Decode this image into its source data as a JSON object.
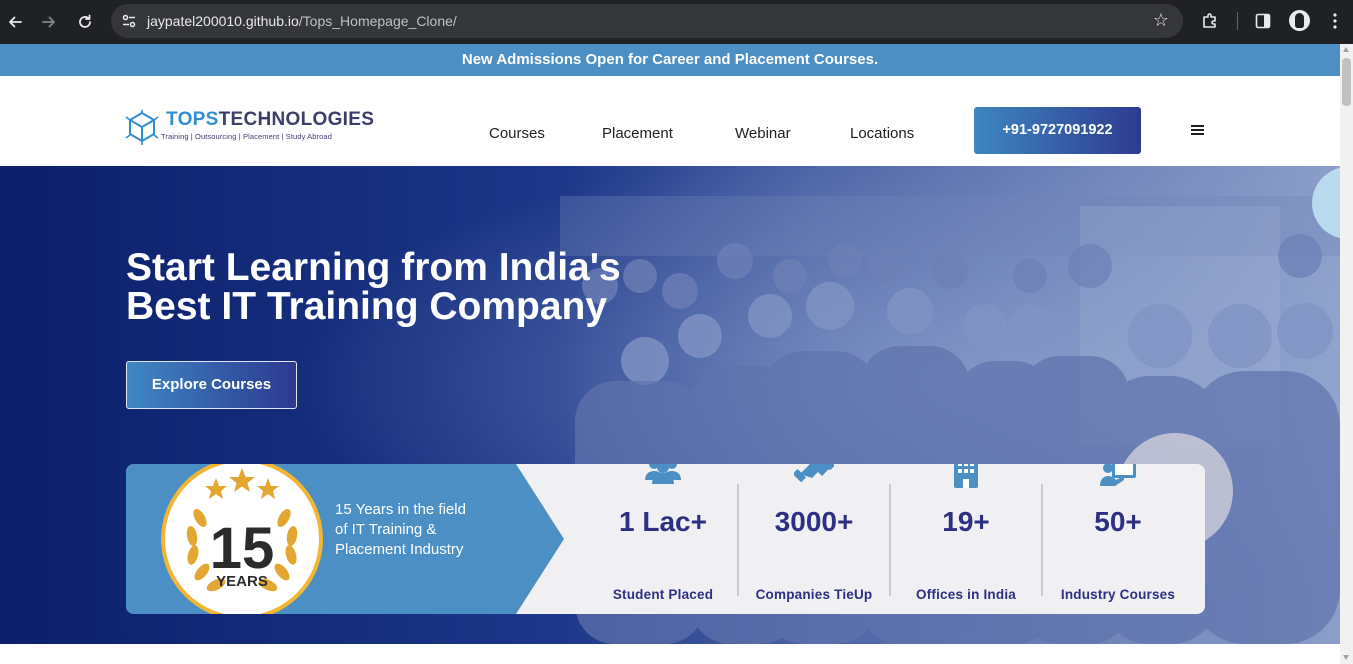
{
  "browser": {
    "url_host": "jaypatel200010.github.io",
    "url_path": "/Tops_Homepage_Clone/",
    "icons": [
      "back-icon",
      "forward-icon",
      "reload-icon",
      "site-settings-icon",
      "bookmark-star-icon",
      "extensions-icon",
      "side-panel-icon",
      "profile-avatar",
      "kebab-menu-icon"
    ]
  },
  "announcement": {
    "text": "New Admissions Open for Career and Placement Courses."
  },
  "header": {
    "logo": {
      "brand_part1": "TOPS",
      "brand_part2": "TECHNOLOGIES",
      "tagline": "Training  |  Outsourcing  |  Placement  |  Study Abroad"
    },
    "nav": [
      {
        "label": "Courses"
      },
      {
        "label": "Placement"
      },
      {
        "label": "Webinar"
      },
      {
        "label": "Locations"
      }
    ],
    "phone_button": "+91-9727091922",
    "menu_icon": "hamburger-icon"
  },
  "hero": {
    "title_line1": "Start Learning from India's",
    "title_line2": "Best IT Training Company",
    "cta": "Explore Courses"
  },
  "stats": {
    "badge_number": "15",
    "badge_caption": "YEARS",
    "years_line1": "15 Years in the field",
    "years_line2": "of IT Training &",
    "years_line3": "Placement Industry",
    "items": [
      {
        "value": "1 Lac+",
        "label": "Student Placed",
        "icon": "students-icon"
      },
      {
        "value": "3000+",
        "label": "Companies TieUp",
        "icon": "handshake-icon"
      },
      {
        "value": "19+",
        "label": "Offices in India",
        "icon": "office-building-icon"
      },
      {
        "value": "50+",
        "label": "Industry Courses",
        "icon": "course-presentation-icon"
      }
    ]
  },
  "colors": {
    "announcement_bg": "#4b8fc5",
    "brand_blue": "#2f8fd0",
    "brand_navy": "#2d2f82",
    "hero_dark": "#0b1f6b",
    "badge_gold": "#e3a630"
  }
}
